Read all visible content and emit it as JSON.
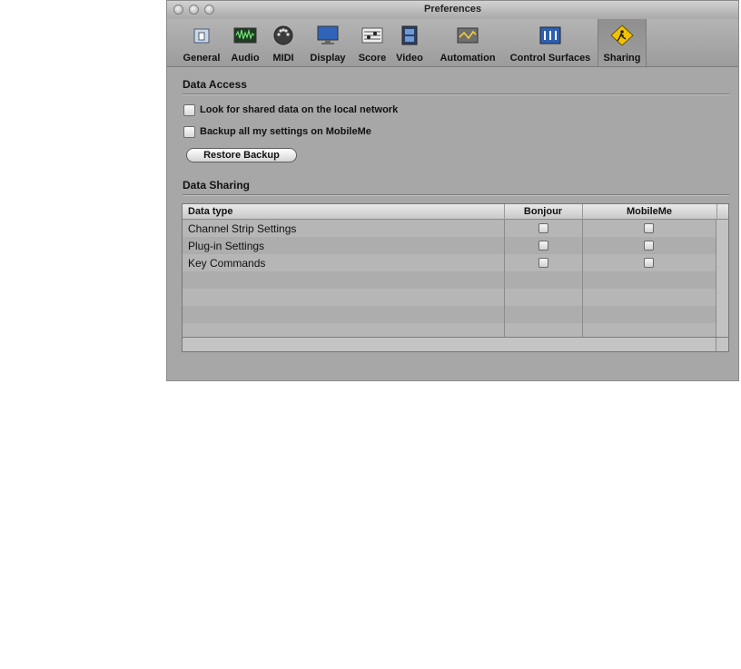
{
  "window": {
    "title": "Preferences"
  },
  "toolbar": {
    "items": [
      {
        "label": "General",
        "icon": "general-icon"
      },
      {
        "label": "Audio",
        "icon": "audio-icon"
      },
      {
        "label": "MIDI",
        "icon": "midi-icon"
      },
      {
        "label": "Display",
        "icon": "display-icon"
      },
      {
        "label": "Score",
        "icon": "score-icon"
      },
      {
        "label": "Video",
        "icon": "video-icon"
      },
      {
        "label": "Automation",
        "icon": "automation-icon"
      },
      {
        "label": "Control Surfaces",
        "icon": "control-surfaces-icon"
      },
      {
        "label": "Sharing",
        "icon": "sharing-icon",
        "selected": true
      }
    ]
  },
  "data_access": {
    "title": "Data Access",
    "look_for_shared": {
      "label": "Look for shared data on the local network",
      "checked": false
    },
    "backup_mobileme": {
      "label": "Backup all my settings on MobileMe",
      "checked": false
    },
    "restore_button": "Restore Backup"
  },
  "data_sharing": {
    "title": "Data Sharing",
    "columns": [
      "Data type",
      "Bonjour",
      "MobileMe"
    ],
    "rows": [
      {
        "type": "Channel Strip Settings",
        "bonjour": false,
        "mobileme": false
      },
      {
        "type": "Plug-in Settings",
        "bonjour": false,
        "mobileme": false
      },
      {
        "type": "Key Commands",
        "bonjour": false,
        "mobileme": false
      }
    ]
  },
  "colors": {
    "window_bg": "#a7a7a7",
    "sharing_icon": "#f2c200"
  }
}
